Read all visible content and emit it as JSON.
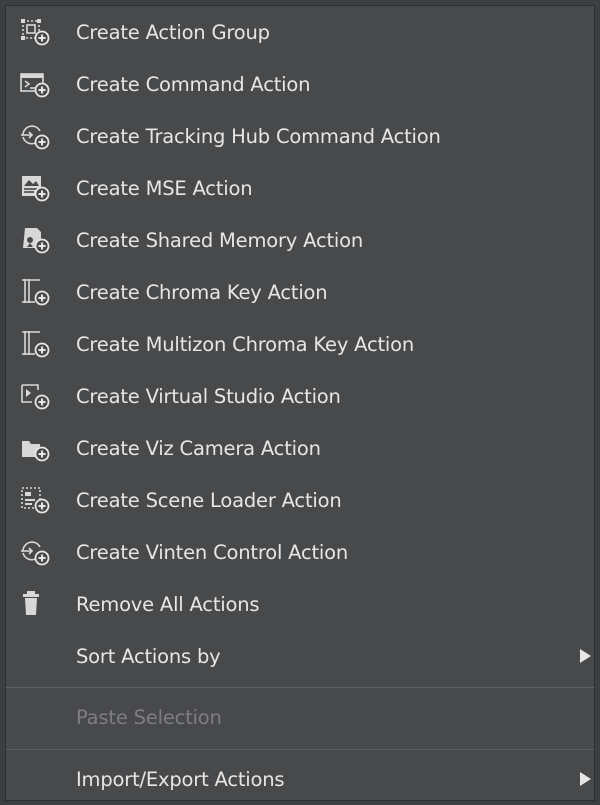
{
  "menu": {
    "items": [
      {
        "label": "Create Action Group",
        "icon": "action-group-icon"
      },
      {
        "label": "Create Command Action",
        "icon": "command-action-icon"
      },
      {
        "label": "Create Tracking Hub Command Action",
        "icon": "tracking-hub-icon"
      },
      {
        "label": "Create MSE Action",
        "icon": "mse-action-icon"
      },
      {
        "label": "Create Shared Memory Action",
        "icon": "shared-memory-icon"
      },
      {
        "label": "Create Chroma Key Action",
        "icon": "chroma-key-icon"
      },
      {
        "label": "Create Multizon Chroma Key Action",
        "icon": "multizon-chroma-key-icon"
      },
      {
        "label": "Create Virtual Studio Action",
        "icon": "virtual-studio-icon"
      },
      {
        "label": "Create Viz Camera Action",
        "icon": "viz-camera-icon"
      },
      {
        "label": "Create Scene Loader Action",
        "icon": "scene-loader-icon"
      },
      {
        "label": "Create Vinten Control Action",
        "icon": "vinten-control-icon"
      },
      {
        "label": "Remove All Actions",
        "icon": "trash-icon"
      }
    ],
    "sort_actions": {
      "label": "Sort Actions by",
      "has_submenu": true
    },
    "paste_selection": {
      "label": "Paste Selection",
      "enabled": false
    },
    "import_export": {
      "label": "Import/Export Actions",
      "has_submenu": true
    }
  },
  "colors": {
    "menu_background": "#48494b",
    "text": "#e6e6e6",
    "disabled_text": "#7d7e80",
    "separator": "#5e5f61"
  }
}
